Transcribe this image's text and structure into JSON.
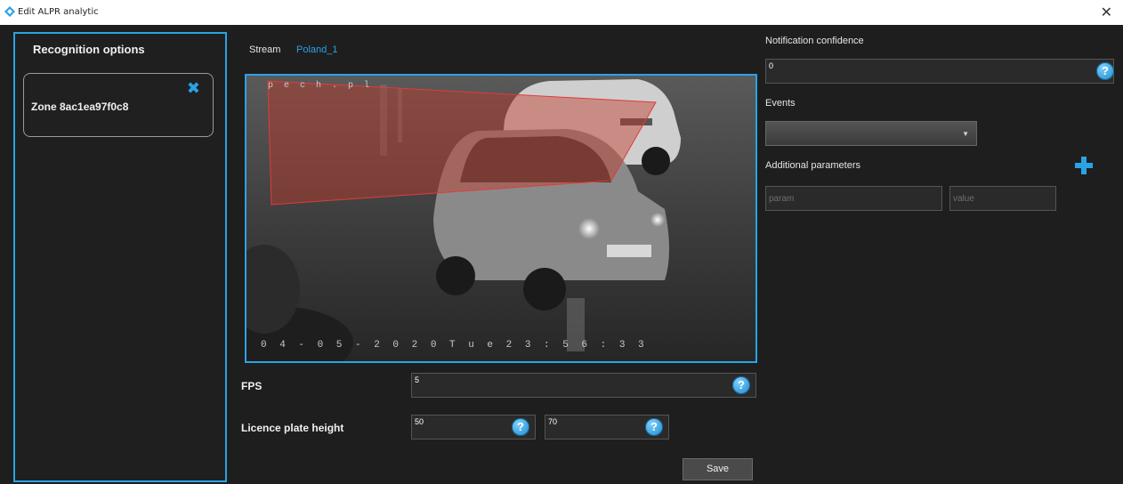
{
  "window": {
    "title": "Edit ALPR analytic",
    "close_glyph": "✕"
  },
  "left_panel": {
    "heading": "Recognition options",
    "zones": [
      {
        "label": "Zone 8ac1ea97f0c8",
        "remove_glyph": "✖"
      }
    ]
  },
  "stream": {
    "label": "Stream",
    "value": "Poland_1"
  },
  "camera": {
    "osd_top": "p e c h . p l",
    "osd_bottom": "0 4 - 0 5 - 2 0 2 0 T u e 2 3 : 5 6 : 3 3",
    "zone_color": "#c0392b"
  },
  "fps": {
    "label": "FPS",
    "value": "5"
  },
  "plate_height": {
    "label": "Licence plate height",
    "min_value": "50",
    "max_value": "70"
  },
  "help_glyph": "?",
  "save_label": "Save",
  "notification": {
    "label": "Notification confidence",
    "value": "0"
  },
  "events": {
    "label": "Events",
    "selected": ""
  },
  "additional": {
    "label": "Additional parameters",
    "param_placeholder": "param",
    "value_placeholder": "value"
  },
  "colors": {
    "accent": "#2aa3e6",
    "background": "#1e1e1e"
  },
  "icons": [
    "app-icon",
    "close-icon",
    "remove-zone-icon",
    "help-icon",
    "plus-icon",
    "dropdown-caret-icon"
  ]
}
